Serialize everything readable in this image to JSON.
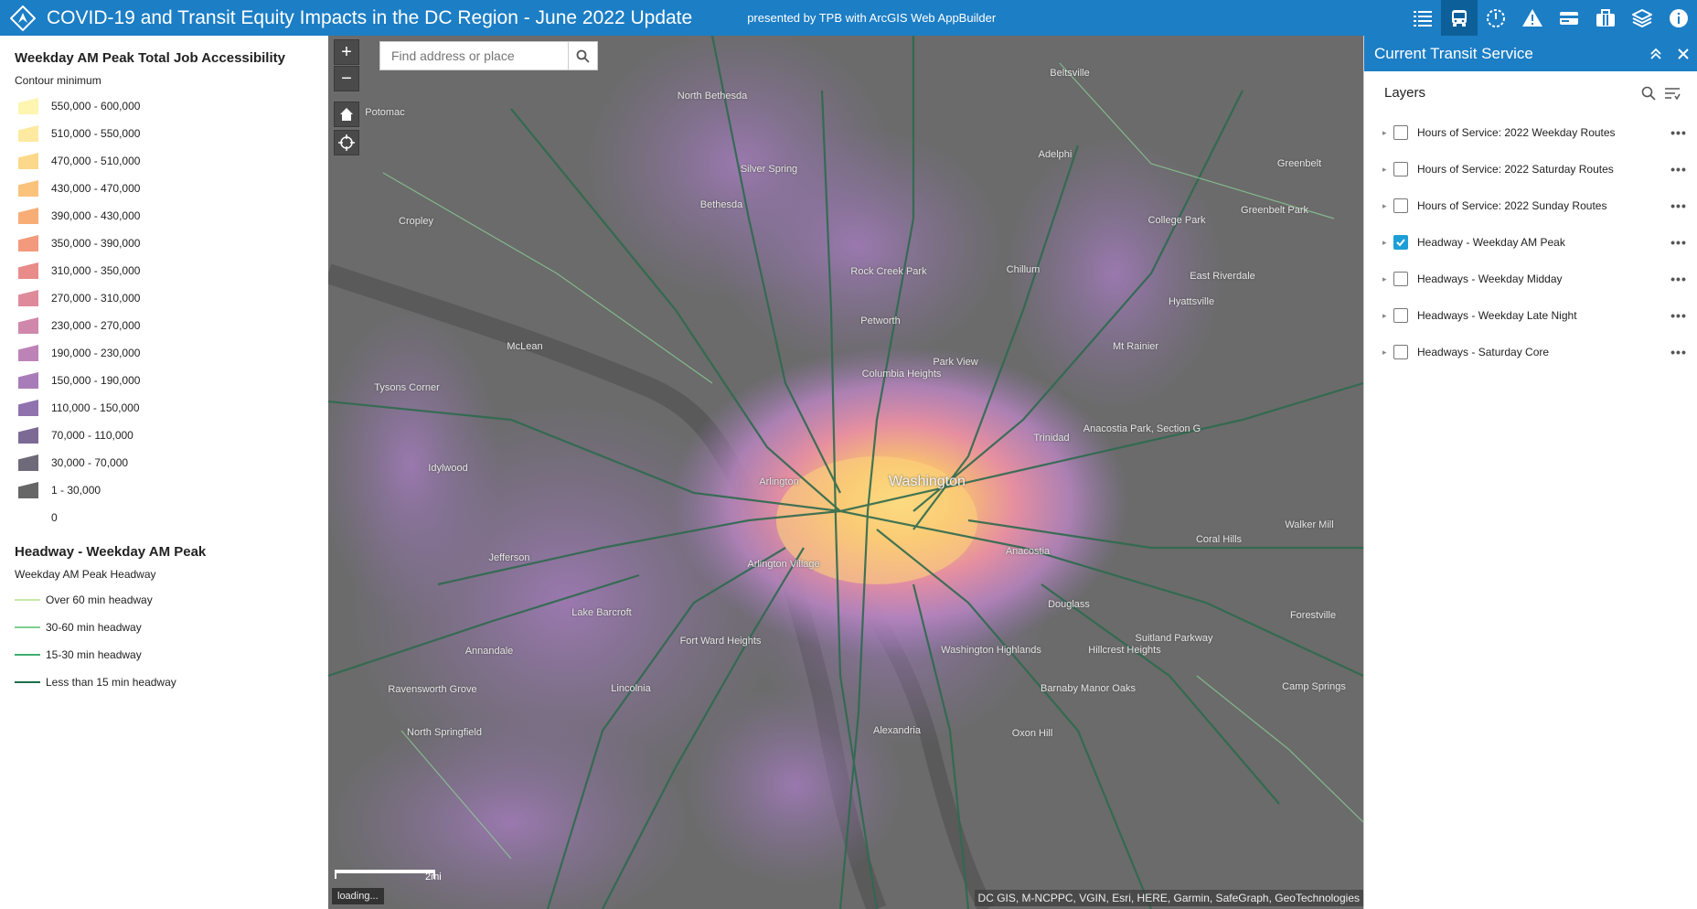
{
  "header": {
    "title": "COVID-19 and Transit Equity Impacts in the DC Region - June 2022 Update",
    "subtitle": "presented by TPB with ArcGIS Web AppBuilder",
    "tools": [
      "list-icon",
      "bus-icon",
      "dashed-circle-icon",
      "warning-icon",
      "card-icon",
      "briefcase-icon",
      "layers-icon",
      "info-icon"
    ]
  },
  "legend": {
    "title": "Weekday AM Peak Total Job Accessibility",
    "subtitle": "Contour minimum",
    "classes": [
      {
        "label": "550,000 - 600,000",
        "color": "#fdf5b0"
      },
      {
        "label": "510,000 - 550,000",
        "color": "#fdeaa0"
      },
      {
        "label": "470,000 - 510,000",
        "color": "#fcd88b"
      },
      {
        "label": "430,000 - 470,000",
        "color": "#fbc27c"
      },
      {
        "label": "390,000 - 430,000",
        "color": "#f8ad77"
      },
      {
        "label": "350,000 - 390,000",
        "color": "#f29a7b"
      },
      {
        "label": "310,000 - 350,000",
        "color": "#e98b89"
      },
      {
        "label": "270,000 - 310,000",
        "color": "#df8a9a"
      },
      {
        "label": "230,000 - 270,000",
        "color": "#cf88ab"
      },
      {
        "label": "190,000 - 230,000",
        "color": "#bd83b7"
      },
      {
        "label": "150,000 - 190,000",
        "color": "#a87cb8"
      },
      {
        "label": "110,000 - 150,000",
        "color": "#9072ae"
      },
      {
        "label": "70,000 - 110,000",
        "color": "#7c6a95"
      },
      {
        "label": "30,000 - 70,000",
        "color": "#6e6a7a"
      },
      {
        "label": "1 - 30,000",
        "color": "#666666"
      },
      {
        "label": "0",
        "color": "#ffffff"
      }
    ],
    "headway_title": "Headway - Weekday AM Peak",
    "headway_subtitle": "Weekday AM Peak Headway",
    "headway_classes": [
      {
        "label": "Over 60 min headway",
        "color": "#c7e8a8"
      },
      {
        "label": "30-60 min headway",
        "color": "#7fcf8d"
      },
      {
        "label": "15-30 min headway",
        "color": "#3fae6f"
      },
      {
        "label": "Less than 15 min headway",
        "color": "#1b6e4a"
      }
    ]
  },
  "map": {
    "search_placeholder": "Find address or place",
    "zoom_in": "+",
    "zoom_out": "−",
    "scale_label": "2mi",
    "loading_text": "loading...",
    "attribution": "DC GIS, M-NCPPC, VGIN, Esri, HERE, Garmin, SafeGraph, GeoTechnologies",
    "labels": [
      {
        "text": "Beltsville"
      },
      {
        "text": "Potomac"
      },
      {
        "text": "North Bethesda"
      },
      {
        "text": "Adelphi"
      },
      {
        "text": "Greenbelt"
      },
      {
        "text": "Silver Spring"
      },
      {
        "text": "Bethesda"
      },
      {
        "text": "Greenbelt Park"
      },
      {
        "text": "College Park"
      },
      {
        "text": "Cropley"
      },
      {
        "text": "Chillum"
      },
      {
        "text": "Rock Creek Park"
      },
      {
        "text": "East Riverdale"
      },
      {
        "text": "Hyattsville"
      },
      {
        "text": "Petworth"
      },
      {
        "text": "McLean"
      },
      {
        "text": "Park View"
      },
      {
        "text": "Mt Rainier"
      },
      {
        "text": "Columbia Heights"
      },
      {
        "text": "Tysons Corner"
      },
      {
        "text": "Anacostia Park, Section G"
      },
      {
        "text": "Trinidad"
      },
      {
        "text": "Idylwood"
      },
      {
        "text": "Arlington"
      },
      {
        "text": "Washington"
      },
      {
        "text": "Walker Mill"
      },
      {
        "text": "Jefferson"
      },
      {
        "text": "Coral Hills"
      },
      {
        "text": "Anacostia"
      },
      {
        "text": "Arlington Village"
      },
      {
        "text": "Douglass"
      },
      {
        "text": "Forestville"
      },
      {
        "text": "Lake Barcroft"
      },
      {
        "text": "Fort Ward Heights"
      },
      {
        "text": "Suitland Parkway"
      },
      {
        "text": "Hillcrest Heights"
      },
      {
        "text": "Annandale"
      },
      {
        "text": "Washington Highlands"
      },
      {
        "text": "Lincolnia"
      },
      {
        "text": "Ravensworth Grove"
      },
      {
        "text": "Barnaby Manor Oaks"
      },
      {
        "text": "Camp Springs"
      },
      {
        "text": "North Springfield"
      },
      {
        "text": "Alexandria"
      },
      {
        "text": "Oxon Hill"
      }
    ]
  },
  "panel": {
    "title": "Current Transit Service",
    "layers_title": "Layers",
    "layers": [
      {
        "label": "Hours of Service: 2022 Weekday Routes",
        "checked": false
      },
      {
        "label": "Hours of Service: 2022 Saturday Routes",
        "checked": false
      },
      {
        "label": "Hours of Service: 2022 Sunday Routes",
        "checked": false
      },
      {
        "label": "Headway - Weekday AM Peak",
        "checked": true
      },
      {
        "label": "Headways - Weekday Midday",
        "checked": false
      },
      {
        "label": "Headways - Weekday Late Night",
        "checked": false
      },
      {
        "label": "Headways - Saturday Core",
        "checked": false
      }
    ],
    "more_label": "•••"
  }
}
